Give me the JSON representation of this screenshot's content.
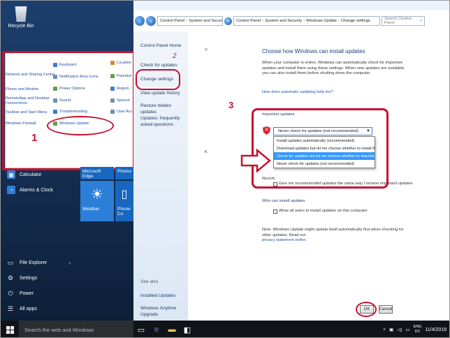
{
  "desktop": {
    "recycle_bin": "Recycle Bin"
  },
  "control_panel_small": {
    "items_col1": [
      "Network and Sharing Center",
      "Phone and Modem",
      "RemoteApp and Desktop Connections",
      "Taskbar and Start Menu",
      "Windows Firewall"
    ],
    "items_col2": [
      "Keyboard",
      "Notification Area Icons",
      "Power Options",
      "Sound",
      "Troubleshooting",
      "Windows Update"
    ],
    "items_col3": [
      "Location",
      "Parental",
      "Region",
      "Speech",
      "User Acc"
    ]
  },
  "start_menu": {
    "apps": [
      "Calculator",
      "Alarms & Clock"
    ],
    "tiles": [
      "Microsoft Edge",
      "Photos",
      "Weather",
      "Phone Co"
    ],
    "bottom": [
      "File Explorer",
      "Settings",
      "Power",
      "All apps"
    ]
  },
  "taskbar": {
    "search_placeholder": "Search the web and Windows",
    "lang_top": "ENG",
    "lang_bottom": "DV",
    "clock": "11/4/2019"
  },
  "window": {
    "breadcrumb": [
      "Control Panel",
      "System and Security",
      "Windows Update",
      "Change settings"
    ],
    "search": "Search Control Panel",
    "left_links": [
      "Control Panel Home",
      "Check for updates",
      "Change settings",
      "View update history",
      "Restore hidden updates",
      "Updates: frequently asked questions"
    ],
    "see_also": "See also",
    "see_also_links": [
      "Installed Updates",
      "Windows Anytime Upgrade"
    ],
    "main_title": "Choose how Windows can install updates",
    "intro": "When your computer is online, Windows can automatically check for important updates and install them using these settings. When new updates are available, you can also install them before shutting down the computer.",
    "help_link": "How does automatic updating help me?",
    "important_heading": "Important updates",
    "dropdown_value": "Never check for updates (not recommended)",
    "options": [
      "Install updates automatically (recommended)",
      "Download updates but let me choose whether to install them",
      "Check for updates but let me choose whether to download and install them",
      "Never check for updates (not recommended)"
    ],
    "recommended_label": "Recom",
    "recommended_cb": "Give me recommended updates the same way I receive important updates",
    "who_heading": "Who can install updates",
    "who_cb": "Allow all users to install updates on this computer",
    "note": "Note: Windows Update might update itself automatically first when checking for other updates. Read our",
    "privacy_link": "privacy statement online.",
    "ok": "OK",
    "cancel": "Cancel"
  },
  "annotations": {
    "step1": "1",
    "step2": "2",
    "step3": "3",
    "accent": "#c8102e"
  }
}
